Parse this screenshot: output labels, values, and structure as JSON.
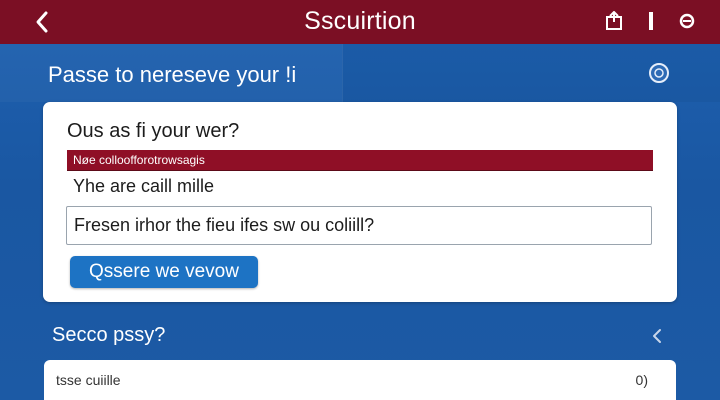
{
  "app_bar": {
    "title": "Sscuirtion",
    "back_icon": "chevron-left-icon",
    "actions": [
      {
        "icon": "share-icon"
      },
      {
        "icon": "divider-icon"
      },
      {
        "icon": "profile-icon"
      }
    ]
  },
  "heading": "Passe to nereseve your !i",
  "card": {
    "question": "Ous as fi your wer?",
    "alert_text": "Nøe colloofforotrowsagis",
    "answer": "Yhe are caill mille",
    "input_value": "Fresen irhor the fieu ifes sw ou coliill?",
    "submit_label": "Qssere we vevow"
  },
  "section": {
    "title": "Secco pssy?"
  },
  "list": [
    {
      "label": "tsse cuiille",
      "value": "0)"
    }
  ],
  "colors": {
    "app_bar": "#7b0f24",
    "background": "#1b56a0",
    "alert": "#8f0f26",
    "button": "#1d73c4"
  }
}
